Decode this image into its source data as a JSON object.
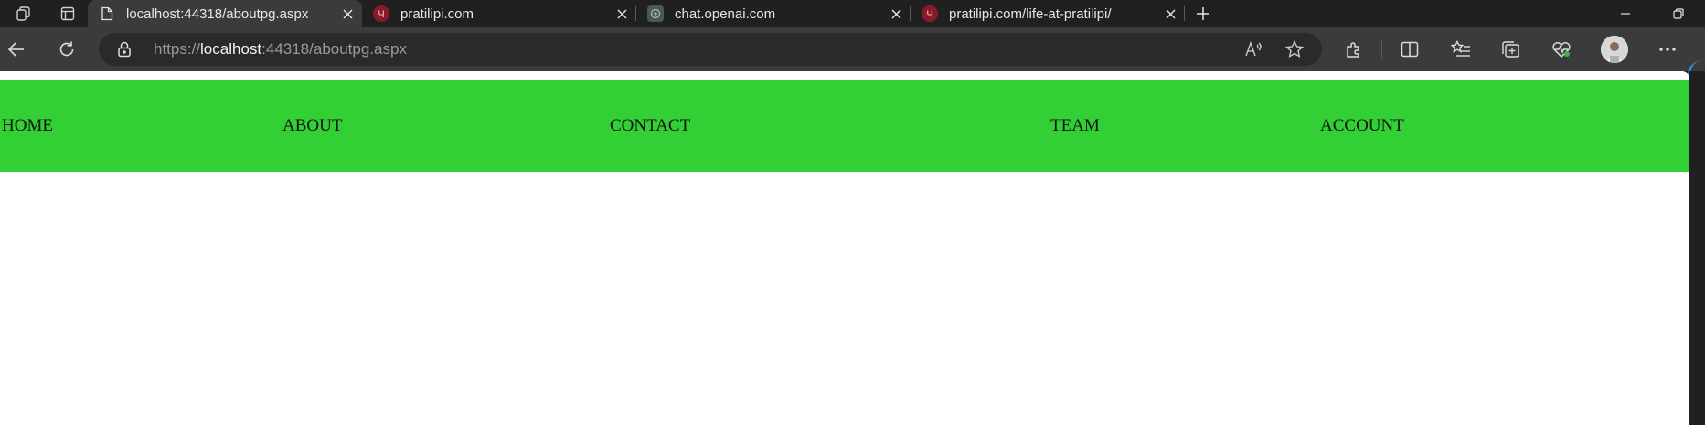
{
  "browser": {
    "tabs": [
      {
        "title": "localhost:44318/aboutpg.aspx",
        "favicon": "page-icon",
        "active": true
      },
      {
        "title": "pratilipi.com",
        "favicon": "pratilipi-icon",
        "active": false
      },
      {
        "title": "chat.openai.com",
        "favicon": "openai-icon",
        "active": false
      },
      {
        "title": "pratilipi.com/life-at-pratilipi/",
        "favicon": "pratilipi-icon",
        "active": false
      }
    ],
    "address": {
      "scheme": "https://",
      "host": "localhost",
      "rest": ":44318/aboutpg.aspx"
    },
    "colors": {
      "chrome_dark": "#202020",
      "toolbar": "#3b3b3b",
      "pratilipi_red": "#8a1a2b"
    }
  },
  "page": {
    "nav_color": "#32d034",
    "nav": {
      "home": "HOME",
      "about": "ABOUT",
      "contact": "CONTACT",
      "team": "TEAM",
      "account": "ACCOUNT"
    }
  }
}
